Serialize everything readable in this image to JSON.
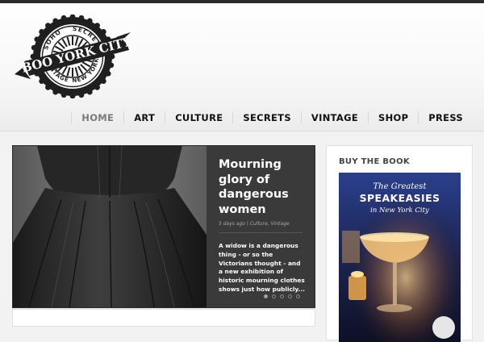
{
  "header": {
    "logo": {
      "name": "BOO YORK CITY",
      "top_left": "SOHO",
      "top_right": "SECRETS",
      "bottom_left": "VINTAGE",
      "bottom_right": "NEW YORK"
    }
  },
  "nav": {
    "items": [
      {
        "label": "HOME",
        "active": true
      },
      {
        "label": "ART",
        "active": false
      },
      {
        "label": "CULTURE",
        "active": false
      },
      {
        "label": "SECRETS",
        "active": false
      },
      {
        "label": "VINTAGE",
        "active": false
      },
      {
        "label": "SHOP",
        "active": false
      },
      {
        "label": "PRESS",
        "active": false
      }
    ]
  },
  "slider": {
    "title": "Mourning glory of dangerous women",
    "meta": "5 days ago | Culture, Vintage",
    "excerpt": "A widow is a dangerous thing - or so the Victorians thought - and a new exhibition of historic mourning clothes shows just how publicly...",
    "slide_count": 5,
    "active_index": 0
  },
  "sidebar": {
    "widget_title": "BUY THE BOOK",
    "book": {
      "line1": "The Greatest",
      "line2": "SPEAKEASIES",
      "line3": "in New York City"
    }
  },
  "colors": {
    "topbar": "#2b2b2b",
    "nav_active": "#7a7a7a",
    "slide_panel": "#3a3a3a"
  }
}
